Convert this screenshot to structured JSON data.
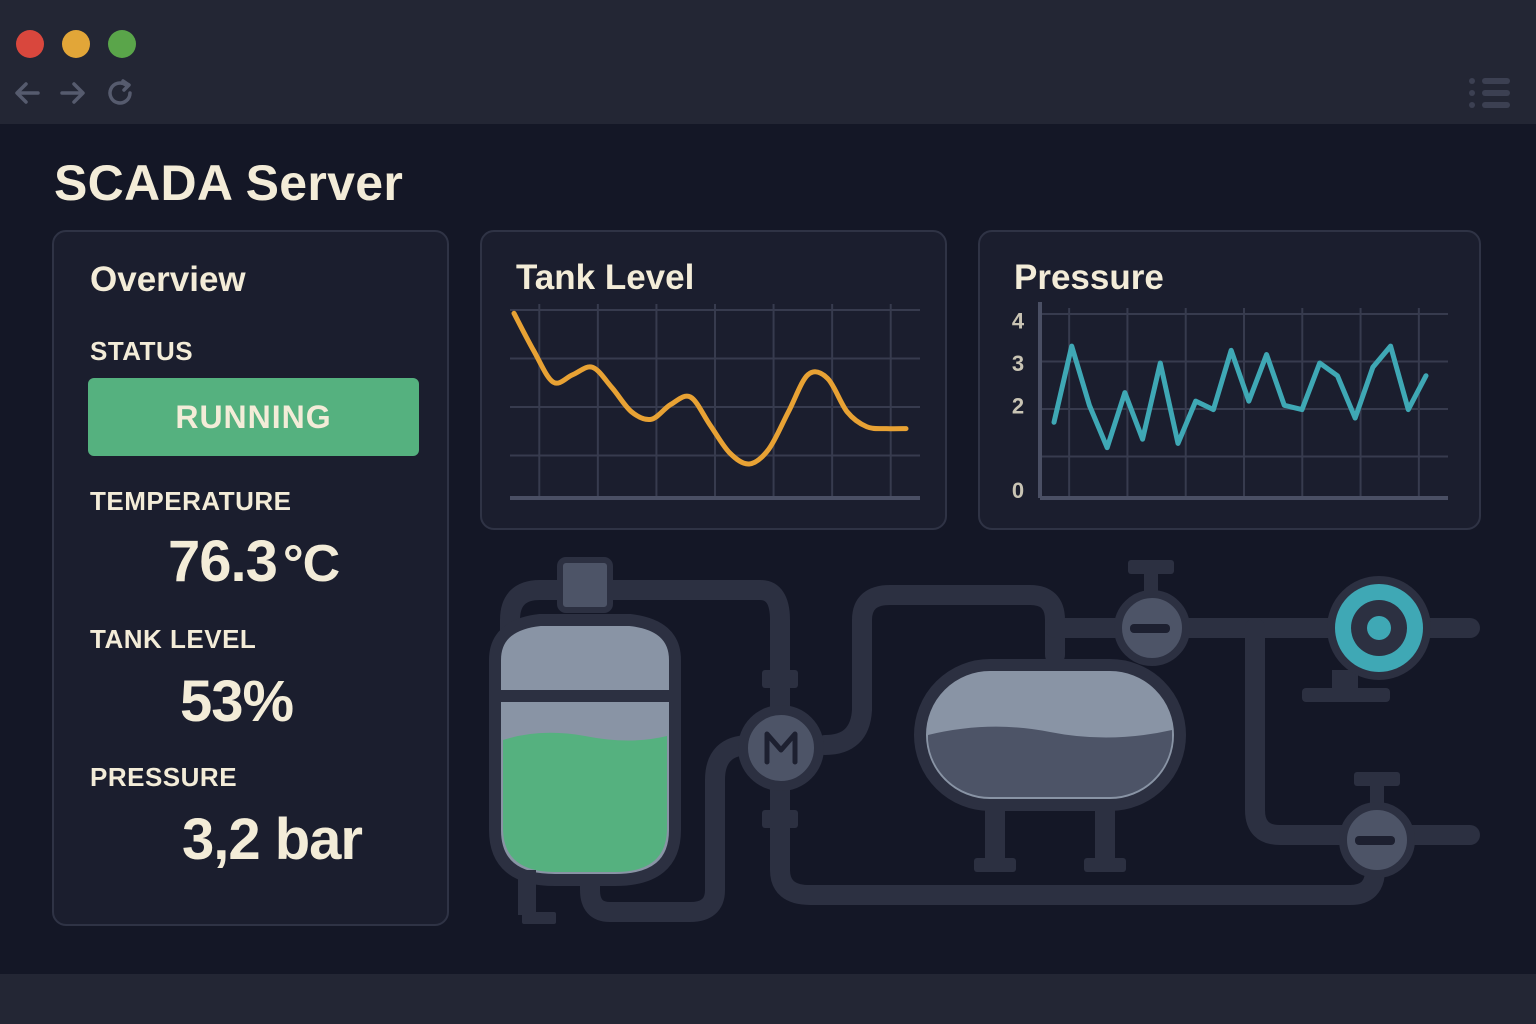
{
  "page": {
    "title": "SCADA Server"
  },
  "overview": {
    "title": "Overview",
    "status_label": "STATUS",
    "status_value": "RUNNING",
    "temperature_label": "TEMPERATURE",
    "temperature_value": "76.3",
    "temperature_unit": "°C",
    "tank_level_label": "TANK LEVEL",
    "tank_level_value": "53%",
    "pressure_label": "PRESSURE",
    "pressure_value": "3,2 bar"
  },
  "colors": {
    "running": "#55b17f",
    "tank_line": "#e8a234",
    "pressure_line": "#3fa8b5",
    "liquid": "#55b17f"
  },
  "icons": [
    "window-close-icon",
    "window-minimize-icon",
    "window-maximize-icon",
    "back-arrow-icon",
    "forward-arrow-icon",
    "reload-icon",
    "list-menu-icon",
    "motor-icon",
    "pump-icon",
    "valve-icon"
  ],
  "chart_data": [
    {
      "type": "line",
      "title": "Tank Level",
      "xlabel": "",
      "ylabel": "",
      "grid": true,
      "x": [
        0,
        1,
        2,
        3,
        4,
        5,
        6,
        7,
        8,
        9,
        10,
        11,
        12,
        13,
        14,
        15,
        16,
        17,
        18,
        19,
        20
      ],
      "series": [
        {
          "values": [
            0.95,
            0.75,
            0.58,
            0.62,
            0.66,
            0.55,
            0.42,
            0.38,
            0.46,
            0.5,
            0.35,
            0.2,
            0.14,
            0.22,
            0.42,
            0.62,
            0.6,
            0.42,
            0.34,
            0.33,
            0.33
          ]
        }
      ],
      "ylim": [
        0,
        1
      ]
    },
    {
      "type": "line",
      "title": "Pressure",
      "xlabel": "",
      "ylabel": "",
      "grid": true,
      "yticks": [
        "0",
        "2",
        "3",
        "4"
      ],
      "x": [
        0,
        1,
        2,
        3,
        4,
        5,
        6,
        7,
        8,
        9,
        10,
        11,
        12,
        13,
        14,
        15,
        16,
        17,
        18,
        19,
        20,
        21
      ],
      "series": [
        {
          "values": [
            1.6,
            3.4,
            2.0,
            1.0,
            2.3,
            1.2,
            3.0,
            1.1,
            2.1,
            1.9,
            3.3,
            2.1,
            3.2,
            2.0,
            1.9,
            3.0,
            2.7,
            1.7,
            2.9,
            3.4,
            1.9,
            2.7
          ]
        }
      ],
      "ylim": [
        0,
        4.3
      ]
    }
  ]
}
